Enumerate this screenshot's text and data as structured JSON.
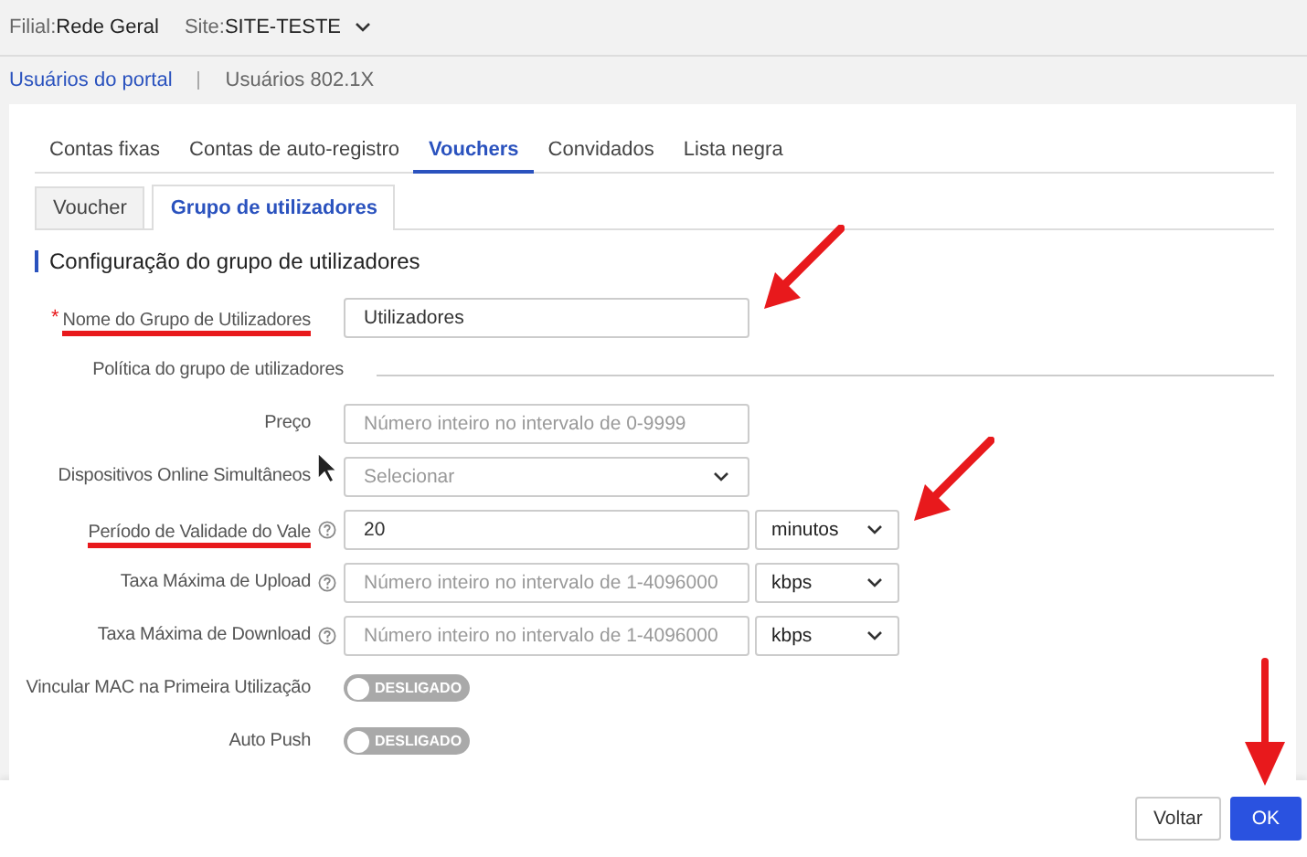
{
  "header": {
    "branch_label": "Filial:",
    "branch": "Rede Geral",
    "site_label": "Site:",
    "site": "SITE-TESTE"
  },
  "user_types": [
    {
      "label": "Usuários do portal",
      "selected": true
    },
    {
      "label": "Usuários 802.1X",
      "selected": false
    }
  ],
  "tabs": [
    {
      "label": "Contas fixas",
      "selected": false
    },
    {
      "label": "Contas de auto-registro",
      "selected": false
    },
    {
      "label": "Vouchers",
      "selected": true
    },
    {
      "label": "Convidados",
      "selected": false
    },
    {
      "label": "Lista negra",
      "selected": false
    }
  ],
  "subtabs": [
    {
      "label": "Voucher",
      "selected": false
    },
    {
      "label": "Grupo de utilizadores",
      "selected": true
    }
  ],
  "required_symbol": "*",
  "section_title": "Configuração do grupo de utilizadores",
  "fields": [
    {
      "kind": "text",
      "label": "Nome do Grupo de Utilizadores",
      "required": true,
      "help": false,
      "underlined": true,
      "arrow": true,
      "value": "Utilizadores"
    },
    {
      "kind": "heading",
      "label": "Política do grupo de utilizadores"
    },
    {
      "kind": "text",
      "label": "Preço",
      "required": false,
      "help": false,
      "underlined": false,
      "arrow": false,
      "placeholder": "Número inteiro no intervalo de 0-9999"
    },
    {
      "kind": "select",
      "label": "Dispositivos Online Simultâneos",
      "required": false,
      "help": false,
      "underlined": false,
      "arrow": false,
      "placeholder": "Selecionar"
    },
    {
      "kind": "text_unit",
      "label": "Período de Validade do Vale",
      "required": false,
      "help": true,
      "underlined": true,
      "arrow": true,
      "value": "20",
      "unit": "minutos"
    },
    {
      "kind": "text_unit",
      "label": "Taxa Máxima de Upload",
      "required": false,
      "help": true,
      "underlined": false,
      "arrow": false,
      "placeholder": "Número inteiro no intervalo de 1-4096000",
      "unit": "kbps"
    },
    {
      "kind": "text_unit",
      "label": "Taxa Máxima de Download",
      "required": false,
      "help": true,
      "underlined": false,
      "arrow": false,
      "placeholder": "Número inteiro no intervalo de 1-4096000",
      "unit": "kbps"
    },
    {
      "kind": "switch",
      "label": "Vincular MAC na Primeira Utilização",
      "required": false,
      "help": false,
      "underlined": false,
      "arrow": false,
      "on": false,
      "state_text": "DESLIGADO"
    },
    {
      "kind": "switch",
      "label": "Auto Push",
      "required": false,
      "help": false,
      "underlined": false,
      "arrow": false,
      "on": false,
      "state_text": "DESLIGADO"
    }
  ],
  "buttons": [
    {
      "label": "Voltar",
      "primary": false,
      "arrow": false
    },
    {
      "label": "OK",
      "primary": true,
      "arrow": true
    }
  ]
}
